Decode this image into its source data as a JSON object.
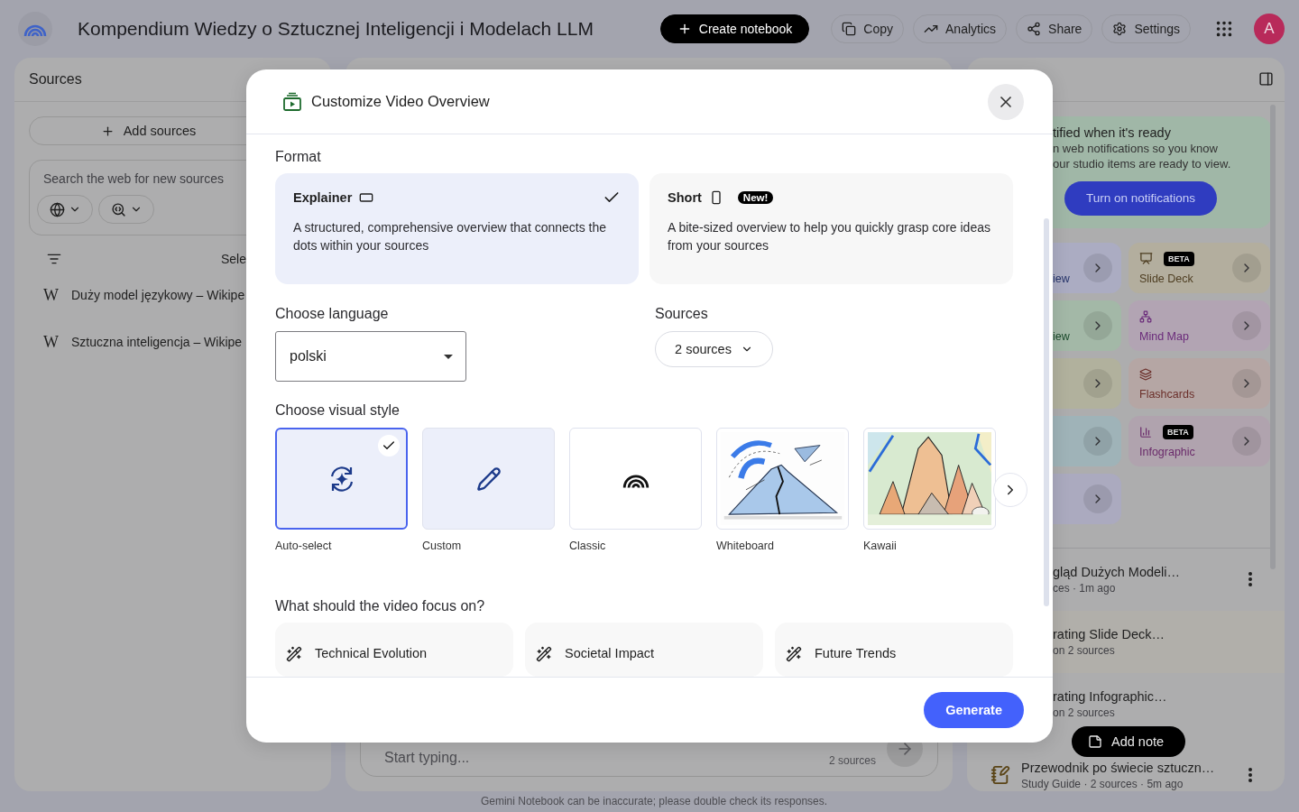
{
  "app": {
    "title": "Kompendium Wiedzy o Sztucznej Inteligencji i Modelach LLM",
    "avatar": "A"
  },
  "toolbar": [
    {
      "kind": "create",
      "label": "Create notebook"
    },
    {
      "kind": "copy",
      "label": "Copy"
    },
    {
      "kind": "analytics",
      "label": "Analytics"
    },
    {
      "kind": "share",
      "label": "Share"
    },
    {
      "kind": "settings",
      "label": "Settings"
    }
  ],
  "sources_panel": {
    "title": "Sources",
    "add_button": "Add sources",
    "search_placeholder": "Search the web for new sources",
    "select_all": "Sele",
    "items": [
      {
        "icon_text": "W",
        "title": "Duży model językowy – Wikipe"
      },
      {
        "icon_text": "W",
        "title": "Sztuczna inteligencja – Wikipe"
      }
    ]
  },
  "chat": {
    "placeholder": "Start typing...",
    "source_count": "2 sources"
  },
  "studio": {
    "notice": {
      "title": "tified when it's ready",
      "lines": [
        "n web notifications so you know",
        "our studio items are ready to view."
      ],
      "button": "Turn on notifications"
    },
    "tiles_left": [
      {
        "label": "iew",
        "color": "#abacc2"
      },
      {
        "label": "iew",
        "color": "#a3b8a7"
      },
      {
        "color": "#b1b19d"
      },
      {
        "color": "#9fb3b8"
      },
      {
        "color": "#abaabf"
      }
    ],
    "tiles_right": [
      {
        "kind": "slides",
        "label": "Slide Deck",
        "badge": "BETA",
        "color": "#b3ae9e"
      },
      {
        "kind": "mindmap",
        "label": "Mind Map",
        "color": "#b2a4b3"
      },
      {
        "kind": "flashcards",
        "label": "Flashcards",
        "color": "#b5a6a4"
      },
      {
        "kind": "infographic",
        "label": "Infographic",
        "badge": "BETA",
        "color": "#b0a3ae"
      }
    ],
    "notes": [
      {
        "kind": "note",
        "title": "gląd Dużych Modeli…",
        "meta": "ces · 1m ago"
      },
      {
        "kind": "generating",
        "title": "rating Slide Deck…",
        "meta": "on 2 sources"
      },
      {
        "kind": "generating",
        "title": "rating Infographic…",
        "meta": "on 2 sources"
      },
      {
        "kind": "study",
        "title": "Przewodnik po świecie sztuczn…",
        "meta": "Study Guide · 2 sources · 5m ago"
      }
    ],
    "add_note": "Add note"
  },
  "footer": "Gemini Notebook can be inaccurate; please double check its responses.",
  "dialog": {
    "title": "Customize Video Overview",
    "format_label": "Format",
    "formats": [
      {
        "kind": "landscape",
        "name": "Explainer",
        "description": "A structured, comprehensive overview that connects the dots within your sources",
        "selected": true
      },
      {
        "kind": "portrait",
        "name": "Short",
        "badge": "New!",
        "description": "A bite-sized overview to help you quickly grasp core ideas from your sources",
        "selected": false
      }
    ],
    "language_label": "Choose language",
    "language": "polski",
    "sources_label": "Sources",
    "sources_value": "2 sources",
    "style_label": "Choose visual style",
    "styles": [
      {
        "kind": "auto",
        "label": "Auto-select",
        "selected": true
      },
      {
        "kind": "custom",
        "label": "Custom",
        "selected": false
      },
      {
        "kind": "classic",
        "label": "Classic",
        "selected": false
      },
      {
        "kind": "whiteboard",
        "label": "Whiteboard",
        "selected": false
      },
      {
        "kind": "kawaii",
        "label": "Kawaii",
        "selected": false
      }
    ],
    "focus_label": "What should the video focus on?",
    "focus_options": [
      "Technical Evolution",
      "Societal Impact",
      "Future Trends"
    ],
    "generate": "Generate"
  }
}
